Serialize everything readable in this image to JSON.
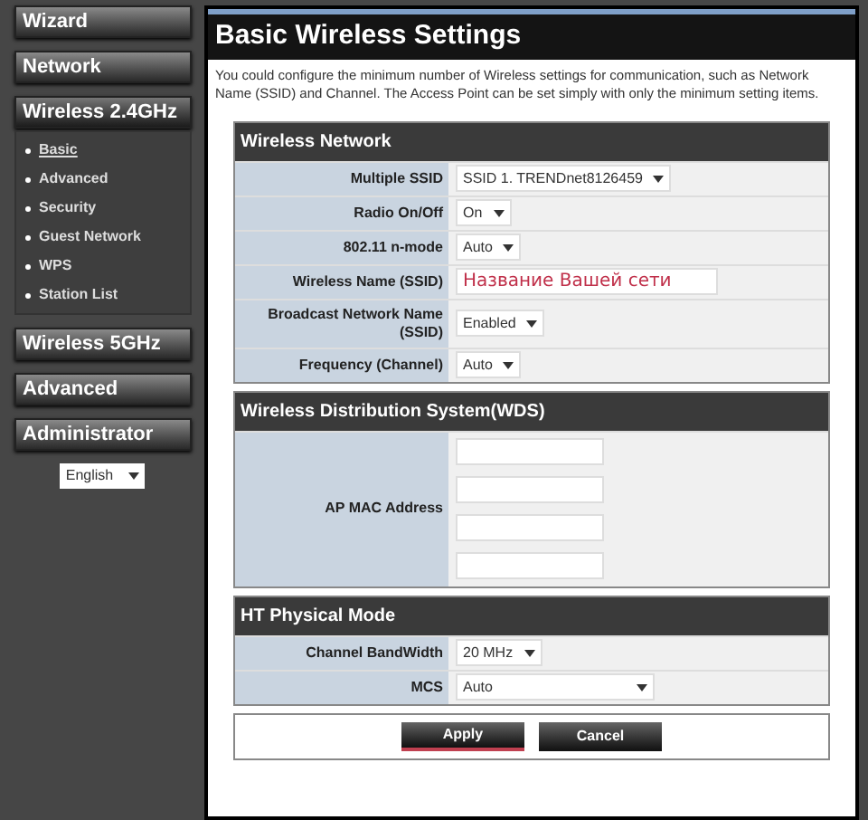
{
  "sidebar": {
    "items": [
      {
        "label": "Wizard",
        "selected": false
      },
      {
        "label": "Network",
        "selected": false
      },
      {
        "label": "Wireless 2.4GHz",
        "selected": true,
        "expanded": true,
        "children": [
          {
            "label": "Basic",
            "selected": true
          },
          {
            "label": "Advanced",
            "selected": false
          },
          {
            "label": "Security",
            "selected": false
          },
          {
            "label": "Guest Network",
            "selected": false
          },
          {
            "label": "WPS",
            "selected": false
          },
          {
            "label": "Station List",
            "selected": false
          }
        ]
      },
      {
        "label": "Wireless 5GHz",
        "selected": false
      },
      {
        "label": "Advanced",
        "selected": false
      },
      {
        "label": "Administrator",
        "selected": false
      }
    ],
    "language": {
      "value": "English"
    }
  },
  "page": {
    "title": "Basic Wireless Settings",
    "description": "You could configure the minimum number of Wireless settings for communication, such as Network Name (SSID) and Channel. The Access Point can be set simply with only the minimum setting items."
  },
  "sections": [
    {
      "title": "Wireless Network",
      "rows": [
        {
          "kind": "select",
          "label": "Multiple SSID",
          "value": "SSID 1. TRENDnet8126459"
        },
        {
          "kind": "select",
          "label": "Radio On/Off",
          "value": "On"
        },
        {
          "kind": "select",
          "label": "802.11 n-mode",
          "value": "Auto"
        },
        {
          "kind": "text",
          "label": "Wireless Name (SSID)",
          "value": "Название Вашей сети"
        },
        {
          "kind": "select",
          "label": "Broadcast Network Name (SSID)",
          "value": "Enabled"
        },
        {
          "kind": "select",
          "label": "Frequency (Channel)",
          "value": "Auto"
        }
      ]
    },
    {
      "title": "Wireless Distribution System(WDS)",
      "rows": [
        {
          "kind": "mac",
          "label": "AP MAC Address"
        }
      ]
    },
    {
      "title": "HT Physical Mode",
      "rows": [
        {
          "kind": "select",
          "label": "Channel BandWidth",
          "value": "20 MHz"
        },
        {
          "kind": "wide-select",
          "label": "MCS",
          "value": "Auto"
        }
      ]
    }
  ],
  "buttons": [
    {
      "label": "Apply",
      "selected": true
    },
    {
      "label": "Cancel",
      "selected": false
    }
  ]
}
